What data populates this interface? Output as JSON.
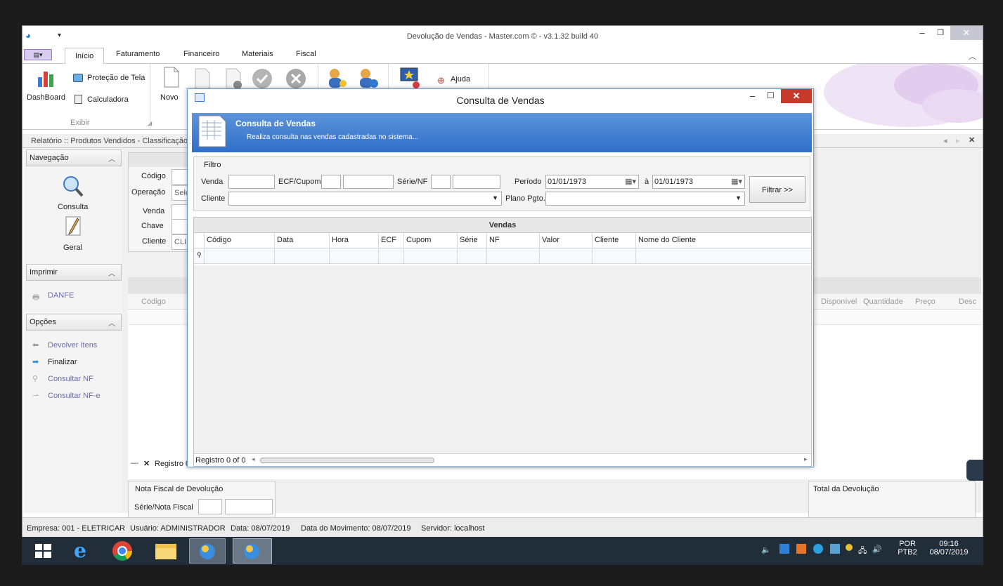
{
  "window": {
    "title": "Devolução de Vendas - Master.com © - v3.1.32 build 40",
    "minimize": "–",
    "restore": "❐",
    "close": "✕"
  },
  "ribbon_tabs": [
    "Início",
    "Faturamento",
    "Financeiro",
    "Materiais",
    "Fiscal"
  ],
  "ribbon": {
    "dashboard": "DashBoard",
    "protecao": "Proteção de Tela",
    "calculadora": "Calculadora",
    "group_exibir": "Exibir",
    "novo": "Novo",
    "ajuda": "Ajuda"
  },
  "doc_tab": "Relatório :: Produtos Vendidos - Classificação I",
  "left_panel": {
    "navegacao": "Navegação",
    "consulta": "Consulta",
    "geral": "Geral",
    "imprimir": "Imprimir",
    "danfe": "DANFE",
    "opcoes": "Opções",
    "devolver": "Devolver Itens",
    "finalizar": "Finalizar",
    "consultar_nf": "Consultar NF",
    "consultar_nfe": "Consultar NF-e"
  },
  "main_form": {
    "codigo": "Código",
    "operacao": "Operação",
    "operacao_value": "Sele",
    "venda": "Venda",
    "chave": "Chave",
    "cliente": "Cliente",
    "cliente_value": "CLIE",
    "grid_codigo": "Código",
    "registro": "Registro 0",
    "disponivel": "Disponível",
    "quantidade": "Quantidade",
    "preco": "Preço",
    "desc": "Desc",
    "nf_devolucao": "Nota Fiscal de Devolução",
    "serie_nota": "Série/Nota Fiscal",
    "total_devolucao": "Total da Devolução"
  },
  "statusbar": {
    "empresa": "Empresa: 001 - ELETRICAR",
    "usuario": "Usuário: ADMINISTRADOR",
    "data": "Data: 08/07/2019",
    "movimento": "Data do Movimento: 08/07/2019",
    "servidor": "Servidor: localhost"
  },
  "dialog": {
    "title": "Consulta de Vendas",
    "banner_title": "Consulta de Vendas",
    "banner_sub": "Realiza consulta nas vendas cadastradas no sistema...",
    "filtro": "Filtro",
    "venda": "Venda",
    "ecf_cupom": "ECF/Cupom",
    "serie_nf": "Série/NF",
    "periodo": "Período",
    "date_from": "01/01/1973",
    "a": "à",
    "date_to": "01/01/1973",
    "cliente": "Cliente",
    "plano": "Plano Pgto.",
    "filtrar": "Filtrar >>",
    "grid_caption": "Vendas",
    "columns": [
      "Código",
      "Data",
      "Hora",
      "ECF",
      "Cupom",
      "Série",
      "NF",
      "Valor",
      "Cliente",
      "Nome do Cliente"
    ],
    "registro": "Registro 0 of 0"
  },
  "taskbar": {
    "lang1": "POR",
    "lang2": "PTB2",
    "time": "09:16",
    "date": "08/07/2019"
  }
}
